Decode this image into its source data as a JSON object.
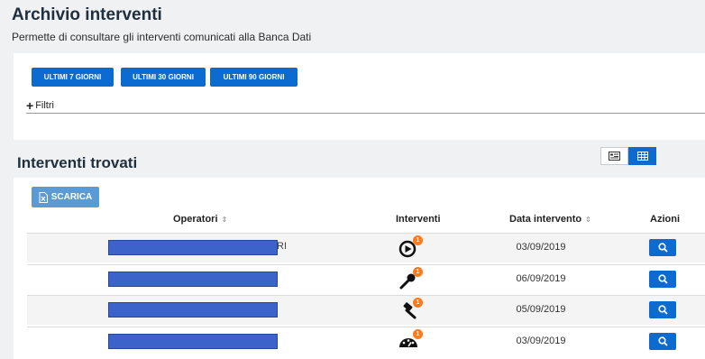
{
  "header": {
    "title": "Archivio interventi",
    "subtitle": "Permette di consultare gli interventi comunicati alla Banca Dati"
  },
  "filters": {
    "range_buttons": [
      "ULTIMI 7 GIORNI",
      "ULTIMI 30 GIORNI",
      "ULTIMI 90 GIORNI"
    ],
    "toggle_label": "Filtri"
  },
  "results": {
    "title": "Interventi trovati",
    "download_label": "SCARICA",
    "view_modes": [
      "card-view-icon",
      "table-view-icon"
    ],
    "active_view": "table",
    "columns": {
      "operatori": "Operatori",
      "interventi": "Interventi",
      "data": "Data intervento",
      "azioni": "Azioni"
    },
    "sort_glyph": "⇕",
    "rows": [
      {
        "operator_suffix": "RI",
        "intervention_icon": "play-circle-icon",
        "badge": "1",
        "date": "03/09/2019"
      },
      {
        "operator_suffix": "",
        "intervention_icon": "microphone-icon",
        "badge": "1",
        "date": "06/09/2019"
      },
      {
        "operator_suffix": "",
        "intervention_icon": "gavel-icon",
        "badge": "1",
        "date": "05/09/2019"
      },
      {
        "operator_suffix": "",
        "intervention_icon": "speedometer-icon",
        "badge": "1",
        "date": "03/09/2019"
      }
    ]
  },
  "colors": {
    "primary": "#0b6bd1",
    "download": "#5b9bd5",
    "badge": "#ff7a1a",
    "redaction": "#3b63c9"
  }
}
